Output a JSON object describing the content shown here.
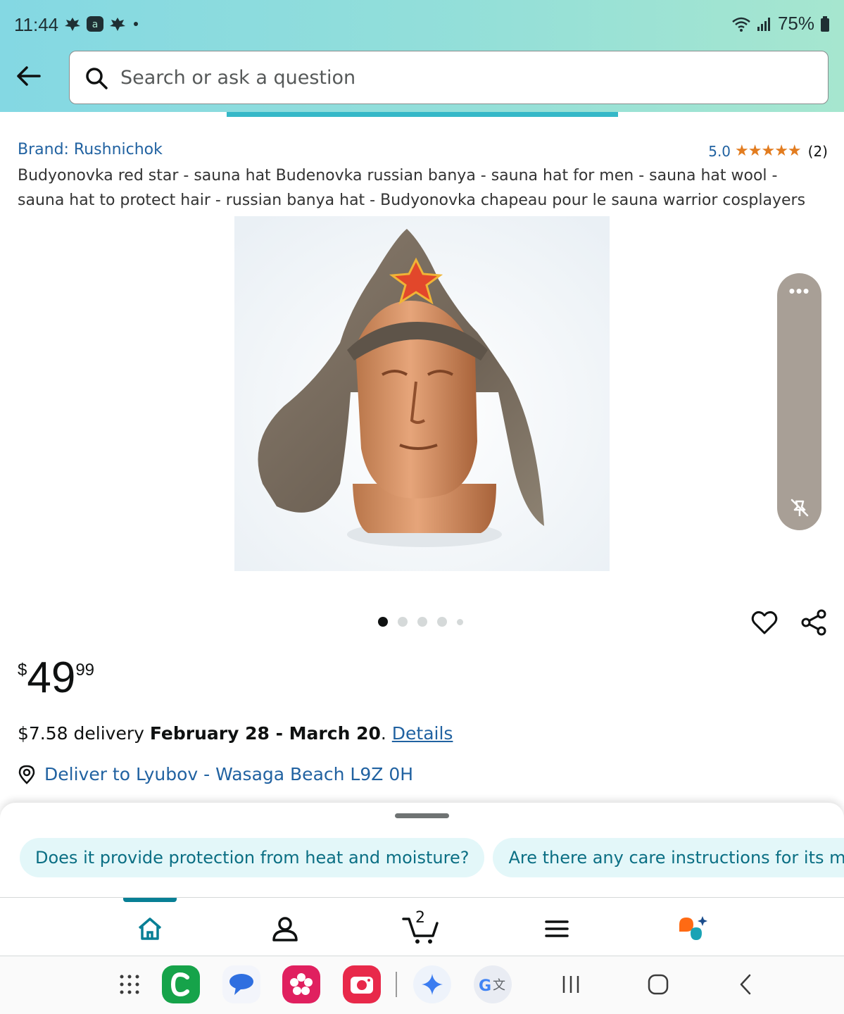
{
  "status_bar": {
    "time": "11:44",
    "battery": "75%",
    "icons": [
      "leaf-notification-icon",
      "a-notification-icon",
      "leaf-notification-icon",
      "dot-icon",
      "wifi-icon",
      "signal-icon",
      "battery-icon"
    ]
  },
  "header": {
    "search_placeholder": "Search or ask a question",
    "accent_color": "#35b8c8"
  },
  "product": {
    "brand": "Brand: Rushnichok",
    "rating_value": "5.0",
    "stars": "★★★★★",
    "rating_count": "(2)",
    "title": "Budyonovka red star - sauna hat Budenovka russian banya - sauna hat for men - sauna hat wool - sauna hat to protect hair - russian banya hat - Budyonovka chapeau pour le sauna warrior cosplayers",
    "image_count": 5,
    "active_image": 1
  },
  "price": {
    "symbol": "$",
    "whole": "49",
    "fraction": "99"
  },
  "delivery": {
    "cost": "$7.58 delivery ",
    "dates": "February 28 - March 20",
    "period": ". ",
    "details_link": "Details",
    "deliver_to": "Deliver to Lyubov - Wasaga Beach L9Z 0H"
  },
  "suggestions": [
    "Does it provide protection from heat and moisture?",
    "Are there any care instructions for its maintenance?"
  ],
  "nav": {
    "cart_count": "2",
    "items": [
      "home-icon",
      "account-icon",
      "cart-icon",
      "menu-icon",
      "rufus-icon"
    ]
  },
  "system_bar": {
    "apps": [
      "app-drawer-icon",
      "c-app-icon",
      "messages-icon",
      "blossom-app-icon",
      "camera-app-icon",
      "gemini-icon",
      "translate-icon"
    ],
    "controls": [
      "recents-icon",
      "home-button-icon",
      "back-icon"
    ]
  }
}
